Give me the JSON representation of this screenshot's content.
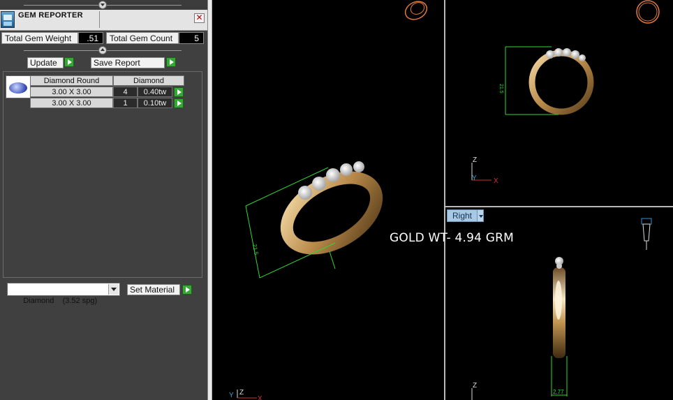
{
  "panel": {
    "title": "GEM REPORTER",
    "close_symbol": "✕",
    "stats": {
      "weight_label": "Total Gem Weight",
      "weight_value": ".51",
      "count_label": "Total Gem Count",
      "count_value": "5"
    },
    "buttons": {
      "update": "Update",
      "save_report": "Save Report",
      "set_material": "Set Material"
    },
    "gem_table": {
      "headers": [
        "Diamond Round",
        "Diamond"
      ],
      "rows": [
        {
          "size": "3.00 X 3.00",
          "count": "4",
          "weight": "0.40tw"
        },
        {
          "size": "3.00 X 3.00",
          "count": "1",
          "weight": "0.10tw"
        }
      ]
    },
    "material_select": {
      "value": "Diamond    (3.52 spg)"
    }
  },
  "viewports": {
    "right_view_tab": "Right",
    "overlay_text": "GOLD WT- 4.94 GRM",
    "dimensions": {
      "perspective": "21.5",
      "front": "21.5",
      "right": "2.77"
    },
    "axis_labels": {
      "z": "Z",
      "x": "X",
      "y": "Y"
    }
  },
  "colors": {
    "gold": "#c8a56a",
    "dimension_line": "#33d633",
    "axis_z": "#dddddd",
    "axis_x": "#d03030",
    "axis_y": "#3da0d0",
    "wire_icon": "#e07a3a"
  },
  "icons": {
    "close": "close-icon",
    "go": "play-arrow-icon",
    "gem": "diamond-icon",
    "dropdown": "chevron-down-icon",
    "wire_ring": "ring-wireframe-icon",
    "pen_nib": "pen-nib-icon"
  }
}
